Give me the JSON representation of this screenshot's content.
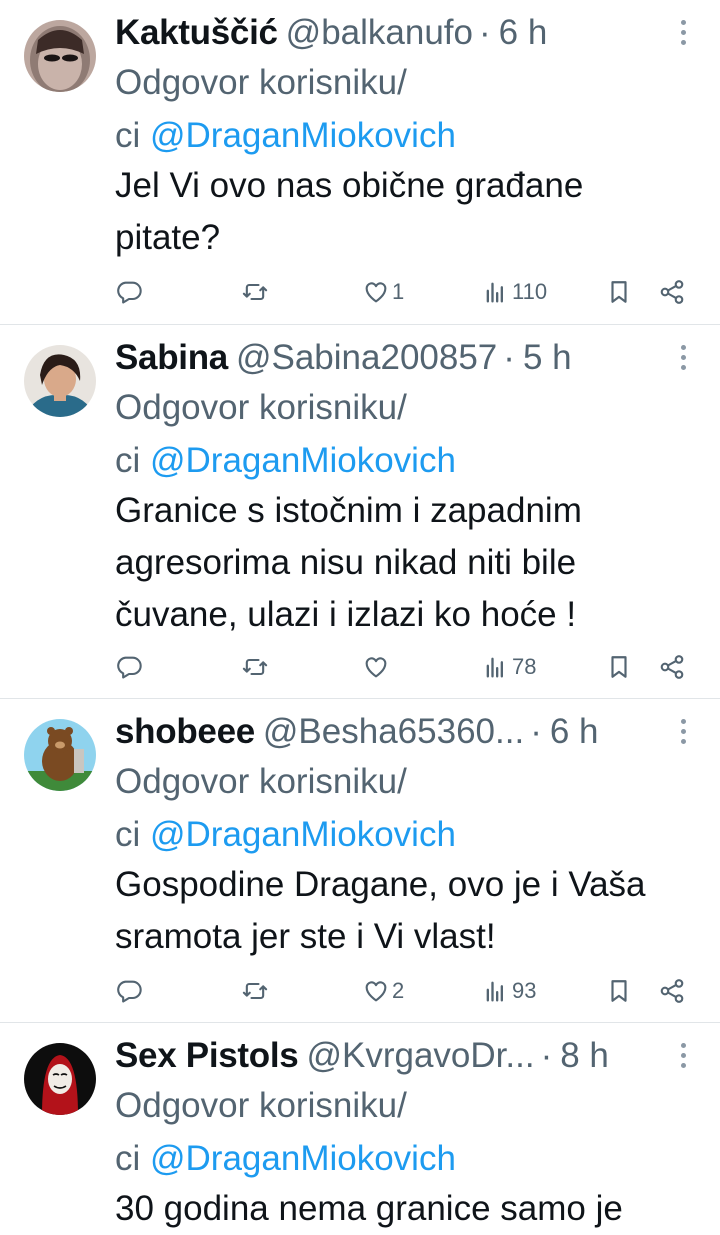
{
  "tweets": [
    {
      "name": "Kaktuščić",
      "handle": "@balkanufo",
      "separator": "·",
      "time": "6 h",
      "reply_prefix": "Odgovor korisniku/",
      "reply_prefix2": "ci ",
      "reply_mention": "@DraganMiokovich",
      "text_lines": [
        "Jel Vi ovo nas obične građane",
        "pitate?"
      ],
      "likes": "1",
      "views": "110"
    },
    {
      "name": "Sabina",
      "handle": "@Sabina200857",
      "separator": "·",
      "time": "5 h",
      "reply_prefix": "Odgovor korisniku/",
      "reply_prefix2": "ci ",
      "reply_mention": "@DraganMiokovich",
      "text_lines": [
        "Granice s istočnim i zapadnim",
        "agresorima nisu nikad niti bile",
        "čuvane, ulazi i izlazi ko  hoće !"
      ],
      "likes": "",
      "views": "78"
    },
    {
      "name": "shobeee",
      "handle": "@Besha65360...",
      "separator": "·",
      "time": "6 h",
      "reply_prefix": "Odgovor korisniku/",
      "reply_prefix2": "ci ",
      "reply_mention": "@DraganMiokovich",
      "text_lines": [
        "Gospodine Dragane, ovo je i Vaša",
        "sramota jer ste i Vi vlast!"
      ],
      "likes": "2",
      "views": "93"
    },
    {
      "name": "Sex Pistols",
      "handle": "@KvrgavoDr...",
      "separator": "·",
      "time": "8 h",
      "reply_prefix": "Odgovor korisniku/",
      "reply_prefix2": "ci ",
      "reply_mention": "@DraganMiokovich",
      "text_lines": [
        "30 godina nema granice samo je"
      ]
    }
  ],
  "icons": {
    "reply": "reply-icon",
    "retweet": "retweet-icon",
    "like": "heart-icon",
    "views": "views-icon",
    "bookmark": "bookmark-icon",
    "share": "share-icon",
    "more": "more-icon"
  },
  "colors": {
    "text": "#0f1419",
    "secondary": "#536471",
    "link": "#1d9bf0",
    "divider": "#e1e5e8"
  }
}
